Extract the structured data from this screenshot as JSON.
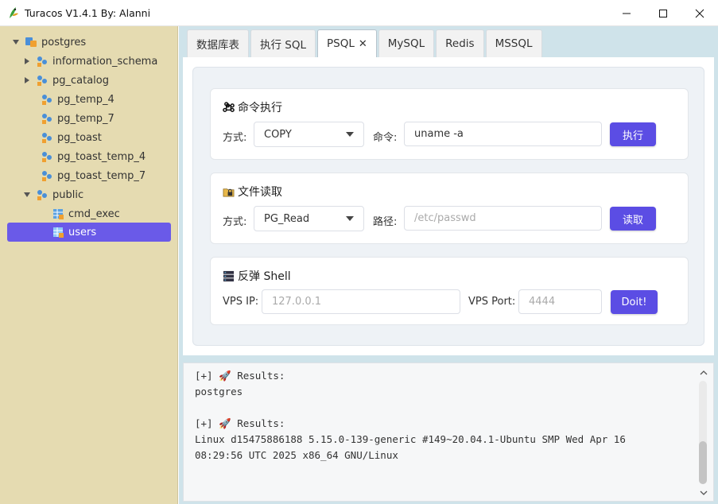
{
  "window": {
    "title": "Turacos V1.4.1 By: Alanni",
    "minimize_icon": "minimize-icon",
    "maximize_icon": "maximize-icon",
    "close_icon": "close-icon"
  },
  "sidebar": {
    "root": "postgres",
    "items": [
      {
        "label": "information_schema",
        "kind": "schema",
        "expandable": true
      },
      {
        "label": "pg_catalog",
        "kind": "schema",
        "expandable": true
      },
      {
        "label": "pg_temp_4",
        "kind": "schema",
        "expandable": false
      },
      {
        "label": "pg_temp_7",
        "kind": "schema",
        "expandable": false
      },
      {
        "label": "pg_toast",
        "kind": "schema",
        "expandable": false
      },
      {
        "label": "pg_toast_temp_4",
        "kind": "schema",
        "expandable": false
      },
      {
        "label": "pg_toast_temp_7",
        "kind": "schema",
        "expandable": false
      },
      {
        "label": "public",
        "kind": "schema",
        "expanded": true
      },
      {
        "label": "cmd_exec",
        "kind": "table"
      },
      {
        "label": "users",
        "kind": "table",
        "selected": true
      }
    ]
  },
  "tabs": [
    {
      "label": "数据库表"
    },
    {
      "label": "执行 SQL"
    },
    {
      "label": "PSQL",
      "active": true,
      "close": "✕"
    },
    {
      "label": "MySQL"
    },
    {
      "label": "Redis"
    },
    {
      "label": "MSSQL"
    }
  ],
  "command_section": {
    "icon": "command-icon",
    "title": "命令执行",
    "method_label": "方式:",
    "method_value": "COPY",
    "command_label": "命令:",
    "command_value": "uname -a",
    "button": "执行"
  },
  "file_section": {
    "icon": "folder-lock-icon",
    "title": "文件读取",
    "method_label": "方式:",
    "method_value": "PG_Read",
    "path_label": "路径:",
    "path_placeholder": "/etc/passwd",
    "button": "读取"
  },
  "shell_section": {
    "icon": "server-icon",
    "title": "反弹 Shell",
    "ip_label": "VPS IP:",
    "ip_placeholder": "127.0.0.1",
    "port_label": "VPS Port:",
    "port_placeholder": "4444",
    "button": "Doit!"
  },
  "output": {
    "lines": [
      "[+] 🚀 Results:",
      "postgres",
      "",
      "[+] 🚀 Results:",
      "Linux d15475886188 5.15.0-139-generic #149~20.04.1-Ubuntu SMP Wed Apr 16",
      "08:29:56 UTC 2025 x86_64 GNU/Linux"
    ]
  },
  "colors": {
    "accent": "#5b4de4",
    "sidebar_bg": "#e5dbb1",
    "selected": "#6a5ae8"
  }
}
